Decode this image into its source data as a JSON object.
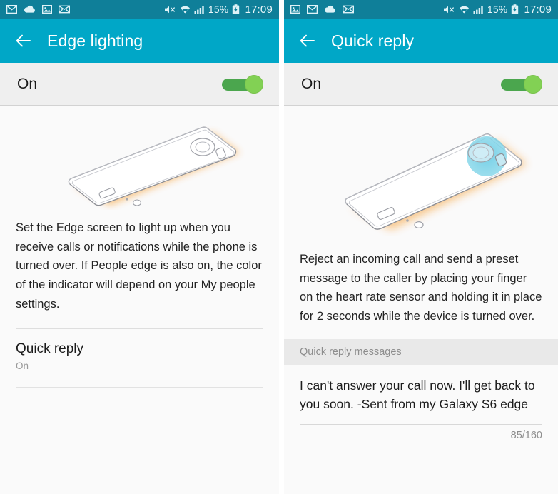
{
  "panels": [
    {
      "id": "edge-lighting",
      "statusbar": {
        "icons": [
          "gmail-icon",
          "cloud-icon",
          "image-icon",
          "mail-icon"
        ],
        "mute_icon": "mute-icon",
        "wifi_icon": "wifi-icon",
        "signal_icon": "signal-icon",
        "battery_percent": "15%",
        "battery_icon": "battery-charging-icon",
        "clock": "17:09"
      },
      "appbar": {
        "back_icon": "back-arrow-icon",
        "title": "Edge lighting"
      },
      "master_toggle": {
        "label": "On",
        "state": "on"
      },
      "illustration": {
        "name": "phone-face-down-edge-glow",
        "glow_color": "#f5a12c",
        "highlight": false
      },
      "description": "Set the Edge screen to light up when you receive calls or notifications while the phone is turned over. If People edge is also on, the color of the indicator will depend on your My people settings.",
      "list_item": {
        "title": "Quick reply",
        "subtitle": "On"
      }
    },
    {
      "id": "quick-reply",
      "statusbar": {
        "icons": [
          "image-icon",
          "gmail-icon",
          "cloud-icon",
          "mail-icon"
        ],
        "mute_icon": "mute-icon",
        "wifi_icon": "wifi-icon",
        "signal_icon": "signal-icon",
        "battery_percent": "15%",
        "battery_icon": "battery-charging-icon",
        "clock": "17:09"
      },
      "appbar": {
        "back_icon": "back-arrow-icon",
        "title": "Quick reply"
      },
      "master_toggle": {
        "label": "On",
        "state": "on"
      },
      "illustration": {
        "name": "phone-face-down-heart-rate-sensor",
        "glow_color": "#f5a12c",
        "highlight": true,
        "highlight_color": "#7fd4e8"
      },
      "description": "Reject an incoming call and send a preset message to the caller by placing your finger on the heart rate sensor and holding it in place for 2 seconds while the device is turned over.",
      "section_header": "Quick reply messages",
      "message": {
        "text": "I can't answer your call now. I'll get back to you soon. -Sent from my Galaxy S6 edge",
        "counter": "85/160"
      }
    }
  ],
  "colors": {
    "statusbar": "#0f7f99",
    "appbar": "#00a7c7",
    "toggle_track_on": "#4ba64e",
    "toggle_thumb_on": "#82d154",
    "page_bg": "#fafafa",
    "band_bg": "#e9e9e9"
  }
}
